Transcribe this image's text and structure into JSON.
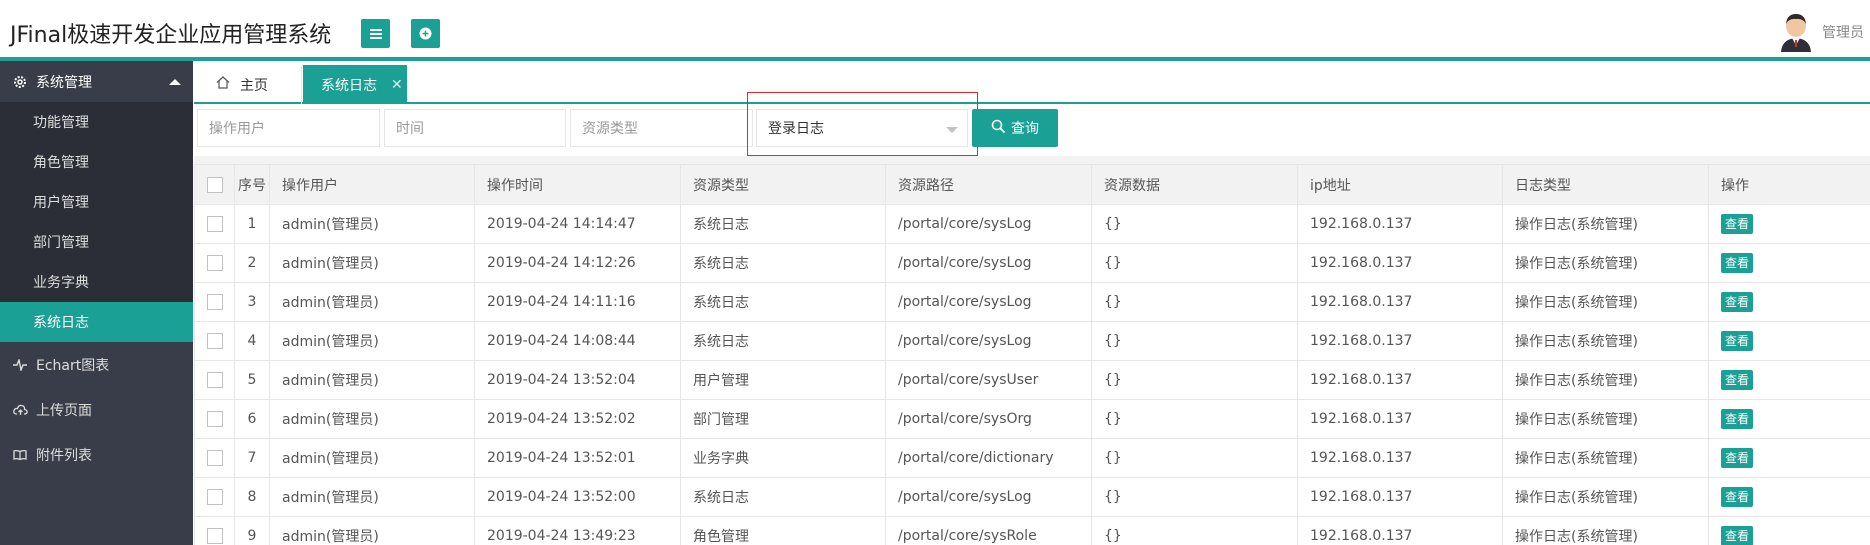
{
  "app": {
    "title": "JFinal极速开发企业应用管理系统",
    "user": "管理员"
  },
  "colors": {
    "accent": "#1aa094",
    "sidebar": "#393d49",
    "highlight": "#e5262c"
  },
  "sidebar": {
    "group": {
      "label": "系统管理",
      "icon": "gear-icon",
      "expanded": true
    },
    "items": [
      {
        "label": "功能管理"
      },
      {
        "label": "角色管理"
      },
      {
        "label": "用户管理"
      },
      {
        "label": "部门管理"
      },
      {
        "label": "业务字典"
      },
      {
        "label": "系统日志",
        "active": true
      }
    ],
    "links": [
      {
        "label": "Echart图表",
        "icon": "pulse-icon"
      },
      {
        "label": "上传页面",
        "icon": "cloud-upload-icon"
      },
      {
        "label": "附件列表",
        "icon": "book-icon"
      }
    ]
  },
  "tabs": [
    {
      "label": "主页",
      "icon": "home-icon"
    },
    {
      "label": "系统日志",
      "active": true,
      "closable": true
    }
  ],
  "filter": {
    "user_placeholder": "操作用户",
    "time_placeholder": "时间",
    "type_placeholder": "资源类型",
    "log_type_selected": "登录日志",
    "query_label": "查询"
  },
  "table": {
    "columns": [
      "序号",
      "操作用户",
      "操作时间",
      "资源类型",
      "资源路径",
      "资源数据",
      "ip地址",
      "日志类型",
      "操作"
    ],
    "action_label": "查看",
    "rows": [
      [
        "1",
        "admin(管理员)",
        "2019-04-24 14:14:47",
        "系统日志",
        "/portal/core/sysLog",
        "{}",
        "192.168.0.137",
        "操作日志(系统管理)"
      ],
      [
        "2",
        "admin(管理员)",
        "2019-04-24 14:12:26",
        "系统日志",
        "/portal/core/sysLog",
        "{}",
        "192.168.0.137",
        "操作日志(系统管理)"
      ],
      [
        "3",
        "admin(管理员)",
        "2019-04-24 14:11:16",
        "系统日志",
        "/portal/core/sysLog",
        "{}",
        "192.168.0.137",
        "操作日志(系统管理)"
      ],
      [
        "4",
        "admin(管理员)",
        "2019-04-24 14:08:44",
        "系统日志",
        "/portal/core/sysLog",
        "{}",
        "192.168.0.137",
        "操作日志(系统管理)"
      ],
      [
        "5",
        "admin(管理员)",
        "2019-04-24 13:52:04",
        "用户管理",
        "/portal/core/sysUser",
        "{}",
        "192.168.0.137",
        "操作日志(系统管理)"
      ],
      [
        "6",
        "admin(管理员)",
        "2019-04-24 13:52:02",
        "部门管理",
        "/portal/core/sysOrg",
        "{}",
        "192.168.0.137",
        "操作日志(系统管理)"
      ],
      [
        "7",
        "admin(管理员)",
        "2019-04-24 13:52:01",
        "业务字典",
        "/portal/core/dictionary",
        "{}",
        "192.168.0.137",
        "操作日志(系统管理)"
      ],
      [
        "8",
        "admin(管理员)",
        "2019-04-24 13:52:00",
        "系统日志",
        "/portal/core/sysLog",
        "{}",
        "192.168.0.137",
        "操作日志(系统管理)"
      ],
      [
        "9",
        "admin(管理员)",
        "2019-04-24 13:49:23",
        "角色管理",
        "/portal/core/sysRole",
        "{}",
        "192.168.0.137",
        "操作日志(系统管理)"
      ]
    ]
  }
}
